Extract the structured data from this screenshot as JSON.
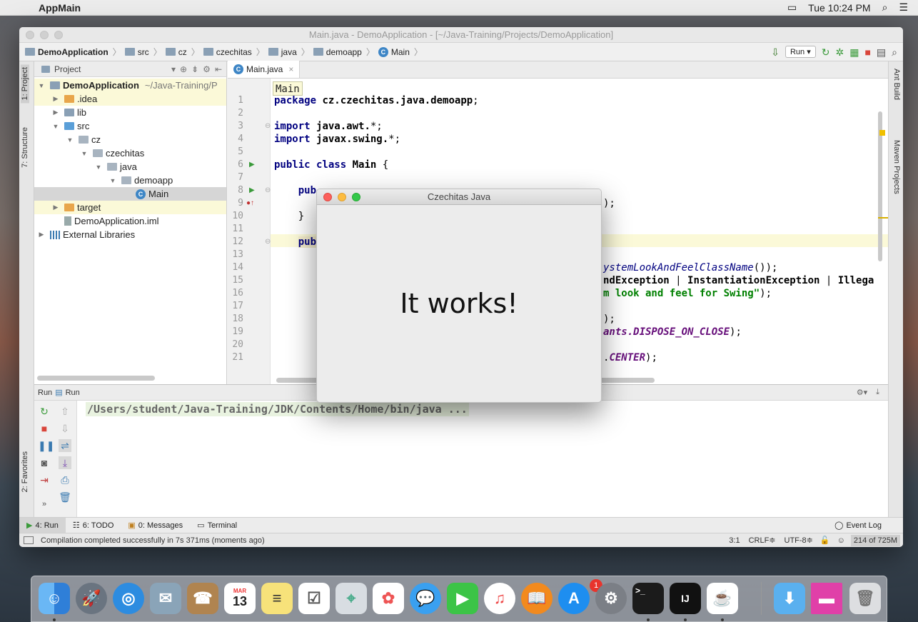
{
  "menubar": {
    "app": "AppMain",
    "time": "Tue 10:24 PM"
  },
  "window": {
    "title": "Main.java - DemoApplication - [~/Java-Training/Projects/DemoApplication]"
  },
  "breadcrumbs": [
    "DemoApplication",
    "src",
    "cz",
    "czechitas",
    "java",
    "demoapp",
    "Main"
  ],
  "toolbar": {
    "run_config": "Run"
  },
  "left_tabs": {
    "project": "1: Project",
    "structure": "7: Structure",
    "favorites": "2: Favorites"
  },
  "right_tabs": {
    "ant": "Ant Build",
    "maven": "Maven Projects"
  },
  "project_panel": {
    "header": "Project",
    "tree": [
      {
        "label": "DemoApplication",
        "extra": "~/Java-Training/P",
        "depth": 0,
        "arrow": "▼",
        "icon": "folder"
      },
      {
        "label": ".idea",
        "depth": 1,
        "arrow": "▶",
        "icon": "folder-orange"
      },
      {
        "label": "lib",
        "depth": 1,
        "arrow": "▶",
        "icon": "folder"
      },
      {
        "label": "src",
        "depth": 1,
        "arrow": "▼",
        "icon": "folder-blue"
      },
      {
        "label": "cz",
        "depth": 2,
        "arrow": "▼",
        "icon": "package"
      },
      {
        "label": "czechitas",
        "depth": 3,
        "arrow": "▼",
        "icon": "package"
      },
      {
        "label": "java",
        "depth": 4,
        "arrow": "▼",
        "icon": "package"
      },
      {
        "label": "demoapp",
        "depth": 5,
        "arrow": "▼",
        "icon": "package"
      },
      {
        "label": "Main",
        "depth": 6,
        "arrow": "",
        "icon": "class"
      },
      {
        "label": "target",
        "depth": 1,
        "arrow": "▶",
        "icon": "folder-orange"
      },
      {
        "label": "DemoApplication.iml",
        "depth": 1,
        "arrow": "",
        "icon": "file"
      },
      {
        "label": "External Libraries",
        "depth": 0,
        "arrow": "▶",
        "icon": "libs"
      }
    ]
  },
  "editor": {
    "tab": "Main.java",
    "breadcrumb_tag": "Main",
    "line_numbers": [
      "1",
      "2",
      "3",
      "4",
      "5",
      "6",
      "7",
      "8",
      "9",
      "10",
      "11",
      "12",
      "13",
      "14",
      "15",
      "16",
      "17",
      "18",
      "19",
      "20",
      "21"
    ]
  },
  "dialog": {
    "title": "Czechitas Java",
    "message": "It works!"
  },
  "run_panel": {
    "header_prefix": "Run",
    "header_name": "Run",
    "console": "/Users/student/Java-Training/JDK/Contents/Home/bin/java ..."
  },
  "bottom_tabs": {
    "run": "4: Run",
    "todo": "6: TODO",
    "messages": "0: Messages",
    "terminal": "Terminal",
    "event_log": "Event Log"
  },
  "status": {
    "message": "Compilation completed successfully in 7s 371ms (moments ago)",
    "position": "3:1",
    "line_sep": "CRLF≑",
    "encoding": "UTF-8≑",
    "memory": "214 of 725M"
  },
  "dock": {
    "calendar_month": "MAR",
    "calendar_day": "13",
    "appstore_badge": "1",
    "intellij": "IJ"
  }
}
